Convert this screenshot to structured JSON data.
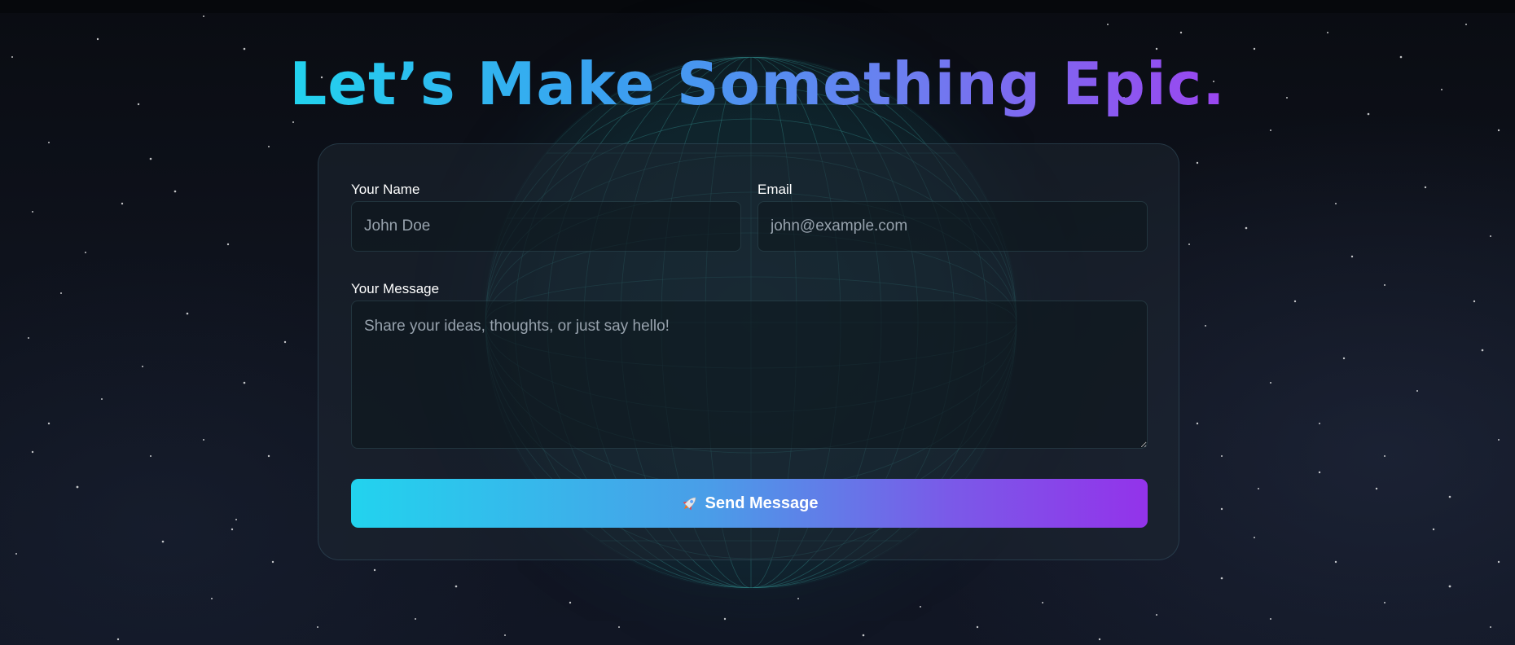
{
  "hero": {
    "title": "Let’s Make Something Epic."
  },
  "form": {
    "name_label": "Your Name",
    "name_placeholder": "John Doe",
    "email_label": "Email",
    "email_placeholder": "john@example.com",
    "message_label": "Your Message",
    "message_placeholder": "Share your ideas, thoughts, or just say hello!",
    "submit_label": "Send Message",
    "submit_icon": "rocket-icon"
  },
  "colors": {
    "gradient_start": "#22d3ee",
    "gradient_end": "#9333ea",
    "background": "#0b0e16"
  }
}
